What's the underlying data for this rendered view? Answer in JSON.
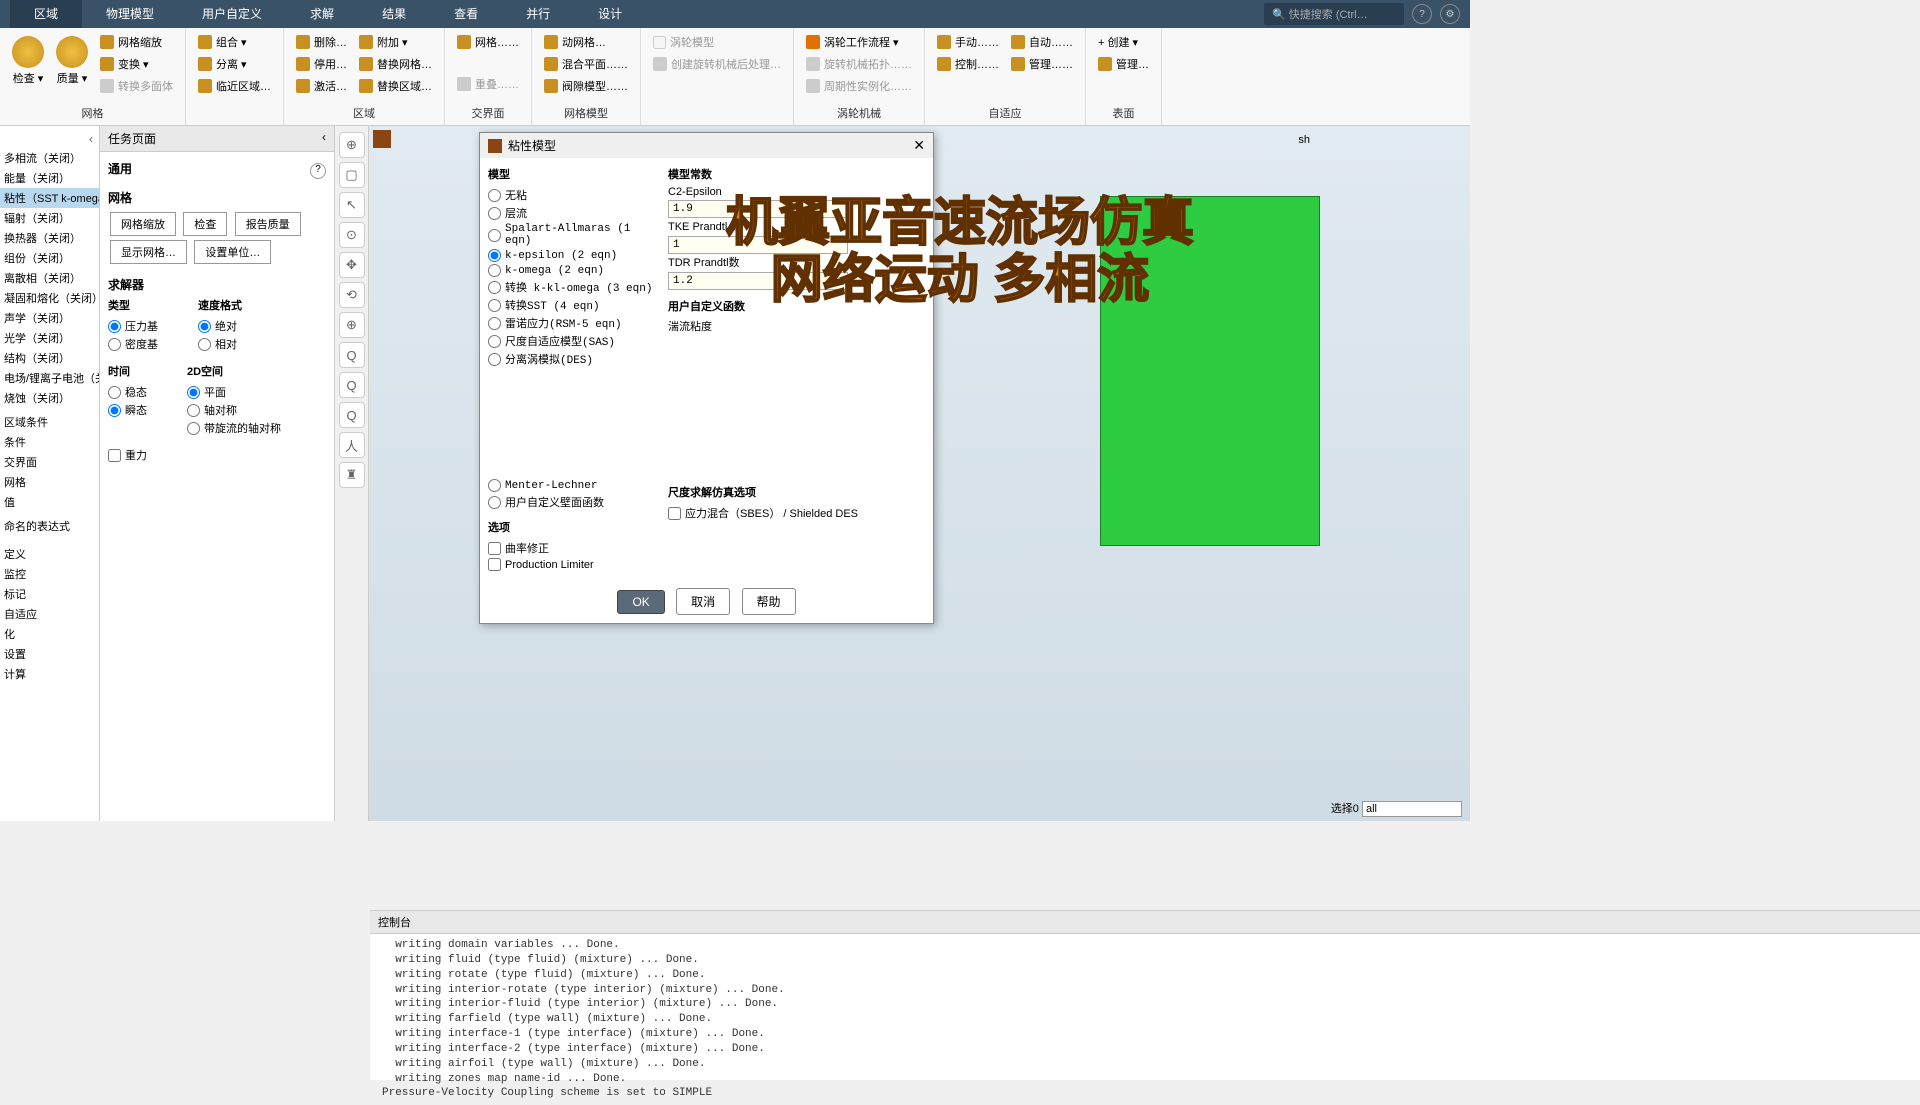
{
  "menubar": {
    "tabs": [
      "区域",
      "物理模型",
      "用户自定义",
      "求解",
      "结果",
      "查看",
      "并行",
      "设计"
    ],
    "search_placeholder": "快捷搜索 (Ctrl…"
  },
  "ribbon": {
    "groups": [
      {
        "title": "网格",
        "big": [
          {
            "label": "检查 ▾"
          },
          {
            "label": "质量 ▾"
          }
        ],
        "items": [
          [
            "网格缩放",
            "变换 ▾",
            "转换多面体"
          ]
        ]
      },
      {
        "title": "",
        "items": [
          [
            "组合 ▾",
            "分离 ▾",
            "临近区域…"
          ]
        ]
      },
      {
        "title": "区域",
        "items": [
          [
            "删除…",
            "停用…",
            "激活…"
          ],
          [
            "附加 ▾",
            "替换网格…",
            "替换区域…"
          ]
        ]
      },
      {
        "title": "交界面",
        "items": [
          [
            "网格……",
            "",
            "重叠……"
          ]
        ]
      },
      {
        "title": "网格模型",
        "items": [
          [
            "动网格…",
            "混合平面……",
            "阀隙模型……"
          ]
        ]
      },
      {
        "title": "",
        "disabled": true,
        "items": [
          [
            "涡轮模型",
            "创建旋转机械后处理…",
            ""
          ]
        ]
      },
      {
        "title": "涡轮机械",
        "items": [
          [
            "涡轮工作流程 ▾",
            "旋转机械拓扑……",
            "周期性实例化……"
          ]
        ]
      },
      {
        "title": "自适应",
        "items": [
          [
            "手动……",
            "控制……"
          ],
          [
            "自动……",
            "管理……"
          ]
        ]
      },
      {
        "title": "表面",
        "items": [
          [
            "+ 创建 ▾",
            "管理…"
          ]
        ]
      }
    ]
  },
  "tree": {
    "items": [
      "多相流（关闭）",
      "能量（关闭）",
      "粘性（SST k-omega",
      "辐射（关闭）",
      "换热器（关闭）",
      "组份（关闭）",
      "离散相（关闭）",
      "凝固和熔化（关闭）",
      "声学（关闭）",
      "光学（关闭）",
      "结构（关闭）",
      "电场/锂离子电池（关",
      "烧蚀（关闭）",
      "",
      "区域条件",
      "条件",
      "交界面",
      "网格",
      "值",
      "",
      "命名的表达式",
      "",
      "",
      "定义",
      "监控",
      "标记",
      "自适应",
      "化",
      "设置",
      "计算"
    ],
    "selected": 2
  },
  "taskpane": {
    "header": "任务页面",
    "general": "通用",
    "mesh": "网格",
    "buttons": [
      "网格缩放",
      "检查",
      "报告质量",
      "显示网格…",
      "设置单位…"
    ],
    "solver": "求解器",
    "type_label": "类型",
    "type_options": [
      "压力基",
      "密度基"
    ],
    "vel_label": "速度格式",
    "vel_options": [
      "绝对",
      "相对"
    ],
    "time_label": "时间",
    "time_options": [
      "稳态",
      "瞬态"
    ],
    "space_label": "2D空间",
    "space_options": [
      "平面",
      "轴对称",
      "带旋流的轴对称"
    ],
    "gravity": "重力"
  },
  "vtoolbar": [
    "⊕",
    "▢",
    "↖",
    "⊙",
    "✥",
    "⟲",
    "⊕",
    "Q",
    "Q",
    "Q",
    "人",
    "♜"
  ],
  "viewport": {
    "mesh_label": "sh",
    "sel_label": "选择0",
    "sel_value": "all"
  },
  "dialog": {
    "title": "粘性模型",
    "model_label": "模型",
    "models": [
      "无粘",
      "层流",
      "Spalart-Allmaras (1 eqn)",
      "k-epsilon (2 eqn)",
      "k-omega (2 eqn)",
      "转换 k-kl-omega (3 eqn)",
      "转换SST (4 eqn)",
      "雷诺应力(RSM-5 eqn)",
      "尺度自适应模型(SAS)",
      "分离涡模拟(DES)"
    ],
    "model_selected": 3,
    "more_models": [
      "Menter-Lechner",
      "用户自定义壁面函数"
    ],
    "const_label": "模型常数",
    "constants": [
      {
        "label": "C2-Epsilon",
        "value": "1.9"
      },
      {
        "label": "TKE Prandtl 数",
        "value": "1"
      },
      {
        "label": "TDR Prandtl数",
        "value": "1.2"
      }
    ],
    "udf_label": "用户自定义函数",
    "udf_sub": "湍流粘度",
    "options_label": "选项",
    "options": [
      "曲率修正",
      "Production Limiter"
    ],
    "scale_label": "尺度求解仿真选项",
    "scale_opt": "应力混合（SBES） / Shielded DES",
    "ok": "OK",
    "cancel": "取消",
    "help": "帮助"
  },
  "console": {
    "header": "控制台",
    "lines": [
      "  writing domain variables ... Done.",
      "  writing fluid (type fluid) (mixture) ... Done.",
      "  writing rotate (type fluid) (mixture) ... Done.",
      "  writing interior-rotate (type interior) (mixture) ... Done.",
      "  writing interior-fluid (type interior) (mixture) ... Done.",
      "  writing farfield (type wall) (mixture) ... Done.",
      "  writing interface-1 (type interface) (mixture) ... Done.",
      "  writing interface-2 (type interface) (mixture) ... Done.",
      "  writing airfoil (type wall) (mixture) ... Done.",
      "  writing zones map name-id ... Done.",
      "Pressure-Velocity Coupling scheme is set to SIMPLE"
    ]
  },
  "overlay": {
    "line1": "机翼亚音速流场仿真",
    "line2": "网络运动  多相流"
  }
}
